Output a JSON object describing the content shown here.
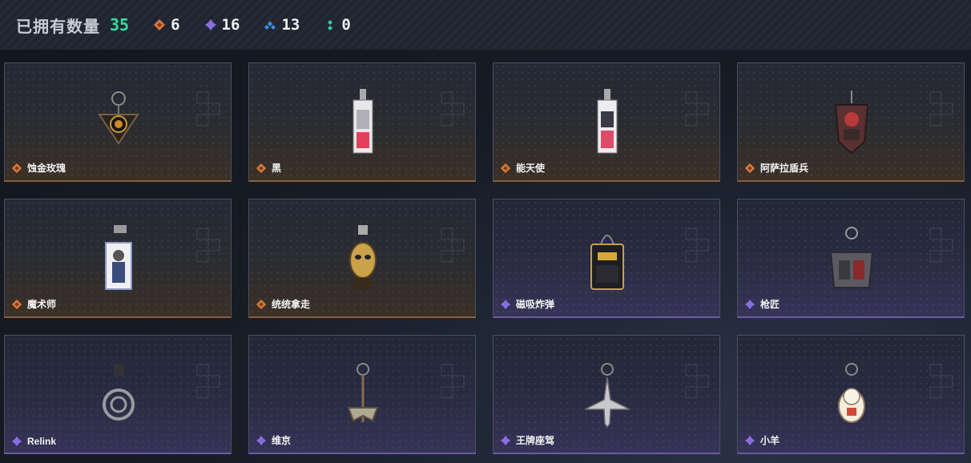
{
  "header": {
    "owned_label": "已拥有数量",
    "owned_count": "35",
    "rarities": [
      {
        "count": "6",
        "color": "#d9773a",
        "icon": "orange-diamond-icon"
      },
      {
        "count": "16",
        "color": "#8a6ee0",
        "icon": "purple-diamond-icon"
      },
      {
        "count": "13",
        "color": "#3d8fe0",
        "icon": "blue-diamond-icon"
      },
      {
        "count": "0",
        "color": "#2fd0a0",
        "icon": "green-dots-icon"
      }
    ]
  },
  "items": [
    {
      "name": "蚀金玫瑰",
      "rarity": "orange",
      "icon": "rose-charm-icon"
    },
    {
      "name": "黑",
      "rarity": "orange",
      "icon": "card-charm-icon"
    },
    {
      "name": "能天使",
      "rarity": "orange",
      "icon": "card-charm-icon"
    },
    {
      "name": "阿萨拉盾兵",
      "rarity": "orange",
      "icon": "shield-soldier-charm-icon"
    },
    {
      "name": "魔术师",
      "rarity": "orange",
      "icon": "magician-card-charm-icon"
    },
    {
      "name": "统统拿走",
      "rarity": "orange",
      "icon": "gold-mask-charm-icon"
    },
    {
      "name": "磁吸炸弹",
      "rarity": "purple",
      "icon": "bomb-charm-icon"
    },
    {
      "name": "枪匠",
      "rarity": "purple",
      "icon": "toolbox-charm-icon"
    },
    {
      "name": "Relink",
      "rarity": "purple",
      "icon": "relink-badge-charm-icon"
    },
    {
      "name": "维京",
      "rarity": "purple",
      "icon": "axe-charm-icon"
    },
    {
      "name": "王牌座驾",
      "rarity": "purple",
      "icon": "jet-charm-icon"
    },
    {
      "name": "小羊",
      "rarity": "purple",
      "icon": "lucky-cat-charm-icon"
    }
  ]
}
